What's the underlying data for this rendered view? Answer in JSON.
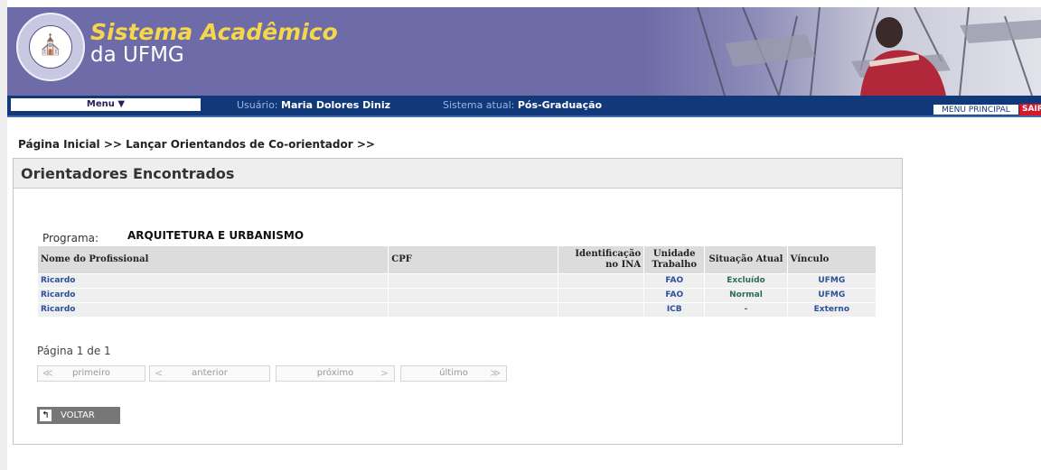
{
  "header": {
    "title_line1": "Sistema Acadêmico",
    "title_line2": "da UFMG",
    "seal": "ufmg-seal-icon"
  },
  "navbar": {
    "menu_label": "Menu ▼",
    "user_label": "Usuário:",
    "user_name": "Maria Dolores Diniz",
    "system_label": "Sistema atual:",
    "system_name": "Pós-Graduação",
    "menu_principal": "MENU PRINCIPAL",
    "sair": "SAIR"
  },
  "breadcrumb": {
    "home": "Página Inicial",
    "separator": ">>",
    "current": "Lançar Orientandos de Co-orientador"
  },
  "panel": {
    "title": "Orientadores Encontrados",
    "programa_label": "Programa:",
    "programa_value": "ARQUITETURA E URBANISMO"
  },
  "table": {
    "headers": [
      "Nome do Profissional",
      "CPF",
      "Identificação no INA",
      "Unidade Trabalho",
      "Situação Atual",
      "Vínculo"
    ],
    "rows": [
      {
        "nome": "Ricardo",
        "cpf": "",
        "ina": "",
        "unidade": "FAO",
        "situacao": "Excluído",
        "vinculo": "UFMG"
      },
      {
        "nome": "Ricardo",
        "cpf": "",
        "ina": "",
        "unidade": "FAO",
        "situacao": "Normal",
        "vinculo": "UFMG"
      },
      {
        "nome": "Ricardo",
        "cpf": "",
        "ina": "",
        "unidade": "ICB",
        "situacao": "-",
        "vinculo": "Externo"
      }
    ]
  },
  "pagination": {
    "info": "Página 1 de 1",
    "first": "primeiro",
    "previous": "anterior",
    "next": "próximo",
    "last": "último"
  },
  "voltar": "VOLTAR",
  "colors": {
    "banner": "#6e6ca8",
    "navbar": "#11397a",
    "title_accent": "#f6d64a",
    "sair": "#d7182a",
    "link": "#2b4f9b"
  }
}
